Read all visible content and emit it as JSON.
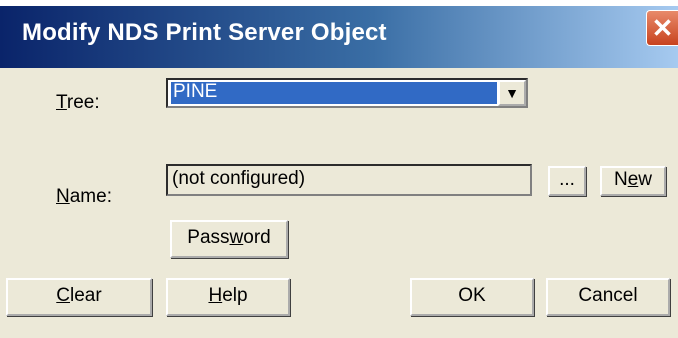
{
  "window": {
    "title": "Modify NDS Print Server Object",
    "close_glyph": "✕"
  },
  "tree": {
    "label": "Tree:",
    "value": "PINE",
    "dropdown_glyph": "▼"
  },
  "name": {
    "label": "Name:",
    "value": "(not configured)"
  },
  "buttons": {
    "browse": "...",
    "new": "New",
    "password": "Password",
    "clear": "Clear",
    "help": "Help",
    "ok": "OK",
    "cancel": "Cancel"
  }
}
